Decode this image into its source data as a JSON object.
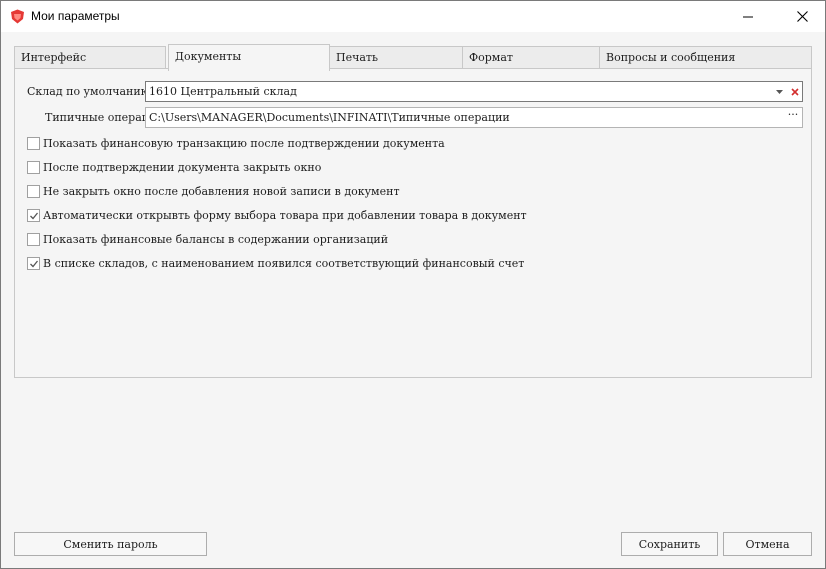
{
  "window": {
    "title": "Мои параметры",
    "icon": "app-shield-icon",
    "accent": "#e53935"
  },
  "tabs": [
    {
      "label": "Интерфейс",
      "active": false
    },
    {
      "label": "Документы",
      "active": true
    },
    {
      "label": "Печать",
      "active": false
    },
    {
      "label": "Формат",
      "active": false
    },
    {
      "label": "Вопросы и сообщения",
      "active": false
    }
  ],
  "documents": {
    "default_warehouse_label": "Склад по умолчанию",
    "default_warehouse_value": "1610   Центральный склад",
    "typical_ops_label": "Типичные операции",
    "typical_ops_value": "C:\\Users\\MANAGER\\Documents\\INFINATI\\Типичные операции",
    "browse_label": "···",
    "options": [
      {
        "label": "Показать финансовую транзакцию после подтверждении документа",
        "checked": false
      },
      {
        "label": "После подтверждении документа закрыть окно",
        "checked": false
      },
      {
        "label": "Не закрыть окно после добавления новой записи в документ",
        "checked": false
      },
      {
        "label": "Автоматически открывть форму выбора товара при добавлении товара в документ",
        "checked": true
      },
      {
        "label": "Показать финансовые балансы в содержании организаций",
        "checked": false
      },
      {
        "label": "В списке складов, с наименованием появился соответствующий финансовый счет",
        "checked": true
      }
    ]
  },
  "footer": {
    "change_password": "Сменить пароль",
    "save": "Сохранить",
    "cancel": "Отмена"
  }
}
